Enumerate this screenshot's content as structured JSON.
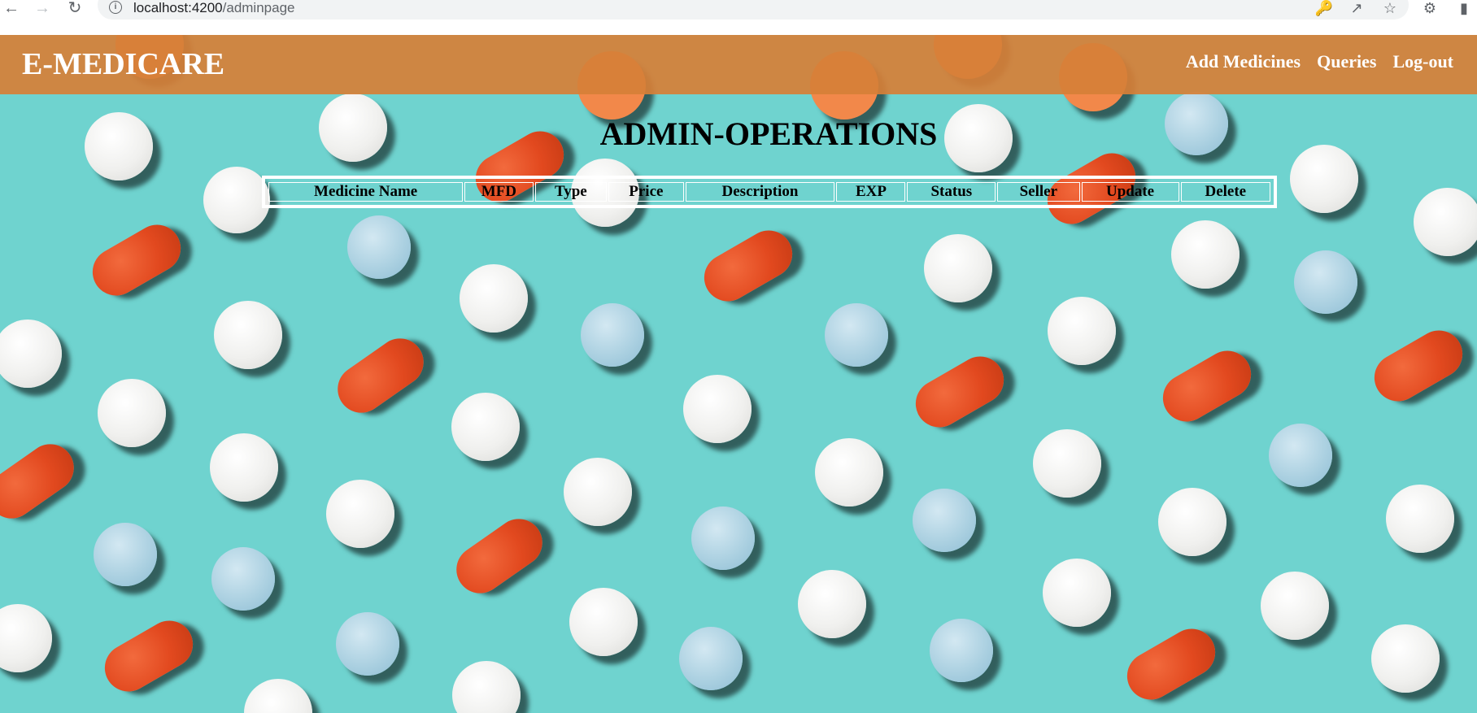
{
  "browser": {
    "url_host": "localhost:4200",
    "url_path": "/adminpage"
  },
  "header": {
    "brand": "E-MEDICARE",
    "nav": [
      "Add Medicines",
      "Queries",
      "Log-out"
    ]
  },
  "main": {
    "title": "ADMIN-OPERATIONS",
    "table_headers": [
      "Medicine Name",
      "MFD",
      "Type",
      "Price",
      "Description",
      "EXP",
      "Status",
      "Seller",
      "Update",
      "Delete"
    ]
  },
  "colors": {
    "header_bg": "#d67f37",
    "page_bg": "#6fd3cf",
    "capsule": "#e2491f"
  }
}
